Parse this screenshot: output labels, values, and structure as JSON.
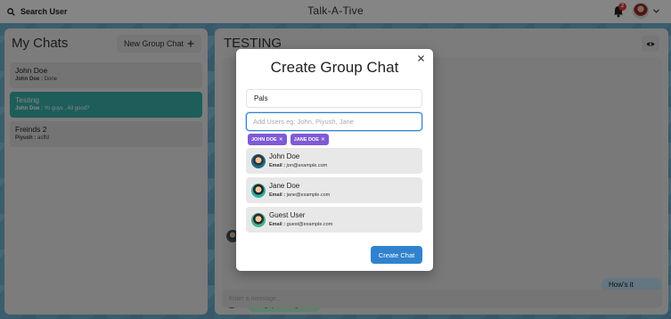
{
  "header": {
    "search_label": "Search User",
    "app_title": "Talk-A-Tive",
    "notification_count": "2"
  },
  "sidebar": {
    "title": "My Chats",
    "new_group_label": "New Group Chat",
    "chats": [
      {
        "name": "John Doe",
        "sender": "John Doe :",
        "preview": "Done",
        "active": false
      },
      {
        "name": "Testing",
        "sender": "John Doe :",
        "preview": "Yo guys , All good?",
        "active": true
      },
      {
        "name": "Freinds 2",
        "sender": "Piyush :",
        "preview": "asffd",
        "active": false
      }
    ]
  },
  "chat": {
    "title": "TESTING",
    "messages": [
      {
        "text": "How's it going?",
        "side": "right"
      },
      {
        "text": "Yo guys , All good?",
        "side": "left"
      }
    ],
    "input_placeholder": "Enter a message.."
  },
  "modal": {
    "title": "Create Group Chat",
    "chat_name_value": "Pals",
    "add_users_placeholder": "Add Users eg: John, Piyush, Jane",
    "selected_chips": [
      "JOHN DOE",
      "JANE DOE"
    ],
    "users": [
      {
        "name": "John Doe",
        "email_label": "Email :",
        "email": "jon@example.com"
      },
      {
        "name": "Jane Doe",
        "email_label": "Email :",
        "email": "jane@example.com"
      },
      {
        "name": "Guest User",
        "email_label": "Email :",
        "email": "guest@example.com"
      }
    ],
    "create_label": "Create Chat"
  },
  "colors": {
    "accent_blue": "#3182ce",
    "teal_active": "#38b2ac",
    "chip_purple": "#805ad5",
    "badge_red": "#e53e3e"
  }
}
